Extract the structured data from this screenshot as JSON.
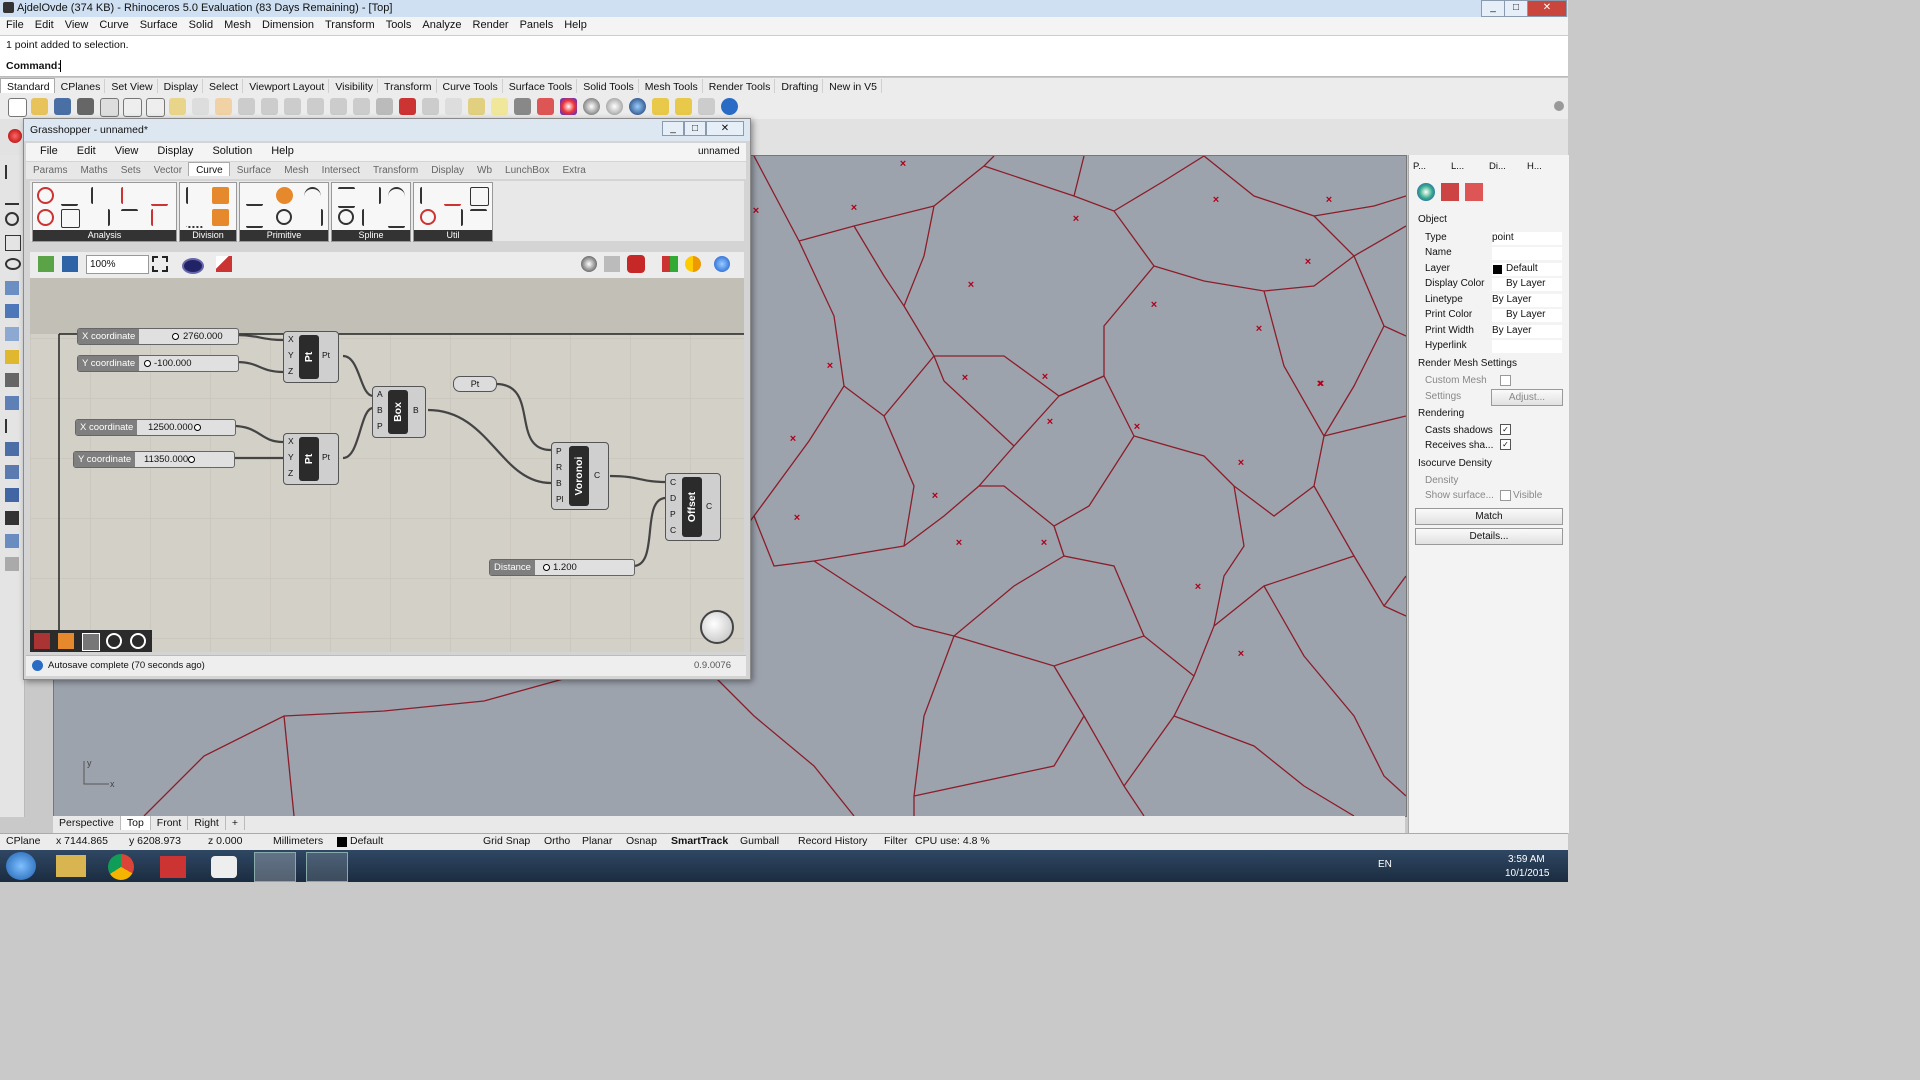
{
  "window": {
    "title": "AjdelOvde (374 KB) - Rhinoceros 5.0 Evaluation (83 Days Remaining) - [Top]"
  },
  "menubar": [
    "File",
    "Edit",
    "View",
    "Curve",
    "Surface",
    "Solid",
    "Mesh",
    "Dimension",
    "Transform",
    "Tools",
    "Analyze",
    "Render",
    "Panels",
    "Help"
  ],
  "command": {
    "history": "1 point added to selection.",
    "prompt_label": "Command:"
  },
  "toolbar_tabs": [
    "Standard",
    "CPlanes",
    "Set View",
    "Display",
    "Select",
    "Viewport Layout",
    "Visibility",
    "Transform",
    "Curve Tools",
    "Surface Tools",
    "Solid Tools",
    "Mesh Tools",
    "Render Tools",
    "Drafting",
    "New in V5"
  ],
  "toolbar_active_tab": "Standard",
  "grasshopper": {
    "title": "Grasshopper - unnamed*",
    "doc_name": "unnamed",
    "menu": [
      "File",
      "Edit",
      "View",
      "Display",
      "Solution",
      "Help"
    ],
    "tabs": [
      "Params",
      "Maths",
      "Sets",
      "Vector",
      "Curve",
      "Surface",
      "Mesh",
      "Intersect",
      "Transform",
      "Display",
      "Wb",
      "LunchBox",
      "Extra"
    ],
    "active_tab": "Curve",
    "ribbon_groups": [
      "Analysis",
      "Division",
      "Primitive",
      "Spline",
      "Util"
    ],
    "zoom": "100%",
    "sliders": [
      {
        "label": "X coordinate",
        "value": "2760.000"
      },
      {
        "label": "Y coordinate",
        "value": "-100.000"
      },
      {
        "label": "X coordinate",
        "value": "12500.000"
      },
      {
        "label": "Y coordinate",
        "value": "11350.000"
      },
      {
        "label": "Distance",
        "value": "1.200"
      }
    ],
    "components": {
      "pt1": {
        "name": "Pt",
        "inputs": [
          "X",
          "Y",
          "Z"
        ],
        "output": "Pt"
      },
      "pt2": {
        "name": "Pt",
        "inputs": [
          "X",
          "Y",
          "Z"
        ],
        "output": "Pt"
      },
      "box": {
        "name": "Box",
        "inputs": [
          "A",
          "B",
          "P"
        ],
        "output": "B"
      },
      "pt_param": {
        "name": "Pt"
      },
      "voronoi": {
        "name": "Voronoi",
        "inputs": [
          "P",
          "R",
          "B",
          "Pl"
        ],
        "output": "C"
      },
      "offset": {
        "name": "Offset",
        "inputs": [
          "C",
          "D",
          "P",
          "C"
        ],
        "output": "C"
      }
    },
    "status": "Autosave complete (70 seconds ago)",
    "version": "0.9.0076"
  },
  "right_panel": {
    "tabs": [
      "P...",
      "L...",
      "Di...",
      "H..."
    ],
    "section_object": "Object",
    "properties": [
      {
        "key": "Type",
        "value": "point"
      },
      {
        "key": "Name",
        "value": ""
      },
      {
        "key": "Layer",
        "value": "Default"
      },
      {
        "key": "Display Color",
        "value": "By Layer"
      },
      {
        "key": "Linetype",
        "value": "By Layer"
      },
      {
        "key": "Print Color",
        "value": "By Layer"
      },
      {
        "key": "Print Width",
        "value": "By Layer"
      },
      {
        "key": "Hyperlink",
        "value": ""
      }
    ],
    "render_mesh": {
      "title": "Render Mesh Settings",
      "custom_mesh": "Custom Mesh",
      "settings": "Settings",
      "adjust": "Adjust..."
    },
    "rendering": {
      "title": "Rendering",
      "casts": "Casts shadows",
      "receives": "Receives sha..."
    },
    "isocurve": {
      "title": "Isocurve Density",
      "density": "Density",
      "show_surface": "Show surface...",
      "visible": "Visible"
    },
    "match_btn": "Match",
    "details_btn": "Details..."
  },
  "viewport_tabs": [
    "Perspective",
    "Top",
    "Front",
    "Right"
  ],
  "viewport_active": "Top",
  "viewport_axes": {
    "x": "x",
    "y": "y"
  },
  "status": {
    "cplane": "CPlane",
    "x": "x 7144.865",
    "y": "y 6208.973",
    "z": "z 0.000",
    "units": "Millimeters",
    "layer": "Default",
    "toggles": [
      "Grid Snap",
      "Ortho",
      "Planar",
      "Osnap",
      "SmartTrack",
      "Gumball",
      "Record History",
      "Filter"
    ],
    "cpu": "CPU use: 4.8 %"
  },
  "taskbar": {
    "lang": "EN",
    "time": "3:59 AM",
    "date": "10/1/2015"
  },
  "colors": {
    "voronoi_line": "#8b1e2a",
    "seed_marker": "#b0001a",
    "viewport_bg": "#9da3ad",
    "accent": "#3a6ea5"
  }
}
